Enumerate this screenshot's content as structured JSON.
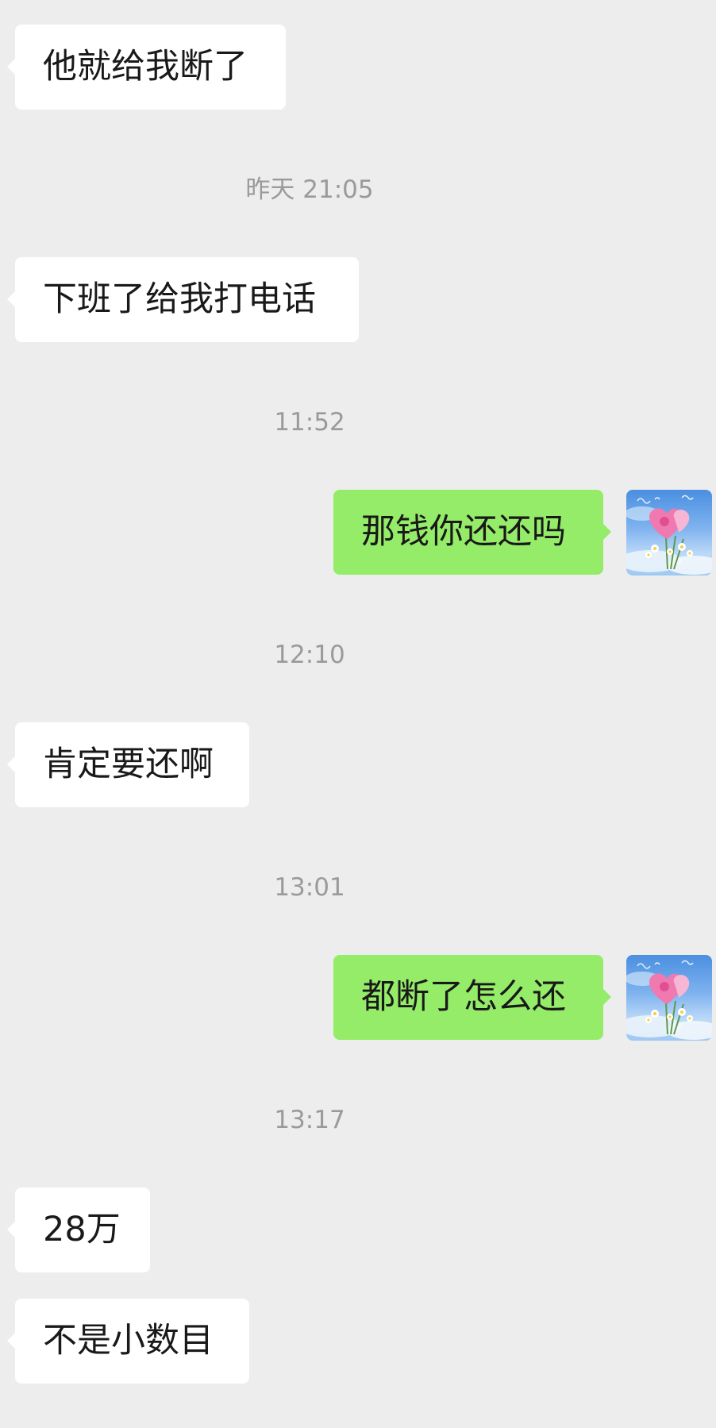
{
  "messages": [
    {
      "type": "in",
      "text": "他就给我断了"
    },
    {
      "type": "time",
      "text": "昨天 21:05"
    },
    {
      "type": "in",
      "text": "下班了给我打电话"
    },
    {
      "type": "time",
      "text": "11:52"
    },
    {
      "type": "out",
      "text": "那钱你还还吗"
    },
    {
      "type": "time",
      "text": "12:10"
    },
    {
      "type": "in",
      "text": "肯定要还啊"
    },
    {
      "type": "time",
      "text": "13:01"
    },
    {
      "type": "out",
      "text": "都断了怎么还"
    },
    {
      "type": "time",
      "text": "13:17"
    },
    {
      "type": "in",
      "text": "28万"
    },
    {
      "type": "in",
      "text": "不是小数目"
    }
  ],
  "avatar_icon": "flower-bouquet-avatar-icon"
}
